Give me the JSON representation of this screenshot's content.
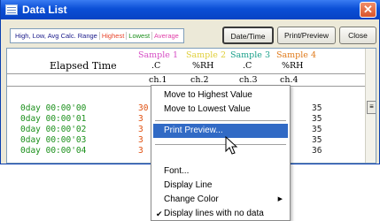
{
  "window": {
    "title": "Data List"
  },
  "toolbar": {
    "tabs": [
      "High, Low, Avg Calc. Range",
      "Highest",
      "Lowest",
      "Average"
    ],
    "date_time": "Date/Time",
    "print_preview": "Print/Preview",
    "close": "Close"
  },
  "colors": {
    "highest": "#e8452c",
    "lowest": "#1c8f1c",
    "average": "#e03fa8",
    "sample1": "#d64cc4",
    "sample2": "#e0cf3a",
    "sample3": "#1aa08a",
    "sample4": "#e07a1a"
  },
  "table": {
    "elapsed_label": "Elapsed Time",
    "samples": [
      "Sample 1",
      "Sample 2",
      "Sample 3",
      "Sample 4"
    ],
    "units": [
      ".C",
      "%RH",
      ".C",
      "%RH"
    ],
    "channels": [
      "ch.1",
      "ch.2",
      "ch.3",
      "ch.4"
    ],
    "rows": [
      {
        "time": "0day 00:00'00",
        "c1": "30",
        "c4": "35"
      },
      {
        "time": "0day 00:00'01",
        "c1": "3",
        "c4": "35"
      },
      {
        "time": "0day 00:00'02",
        "c1": "3",
        "c4": "35"
      },
      {
        "time": "0day 00:00'03",
        "c1": "3",
        "c4": "35"
      },
      {
        "time": "0day 00:00'04",
        "c1": "3",
        "c4": "36"
      }
    ]
  },
  "context_menu": {
    "items": [
      "Move to Highest Value",
      "Move to Lowest Value",
      "Print Preview...",
      "Font...",
      "Display Line",
      "Change Color",
      "Display lines with no data"
    ],
    "checkmark": "✔",
    "submenu_arrow": "▶"
  }
}
